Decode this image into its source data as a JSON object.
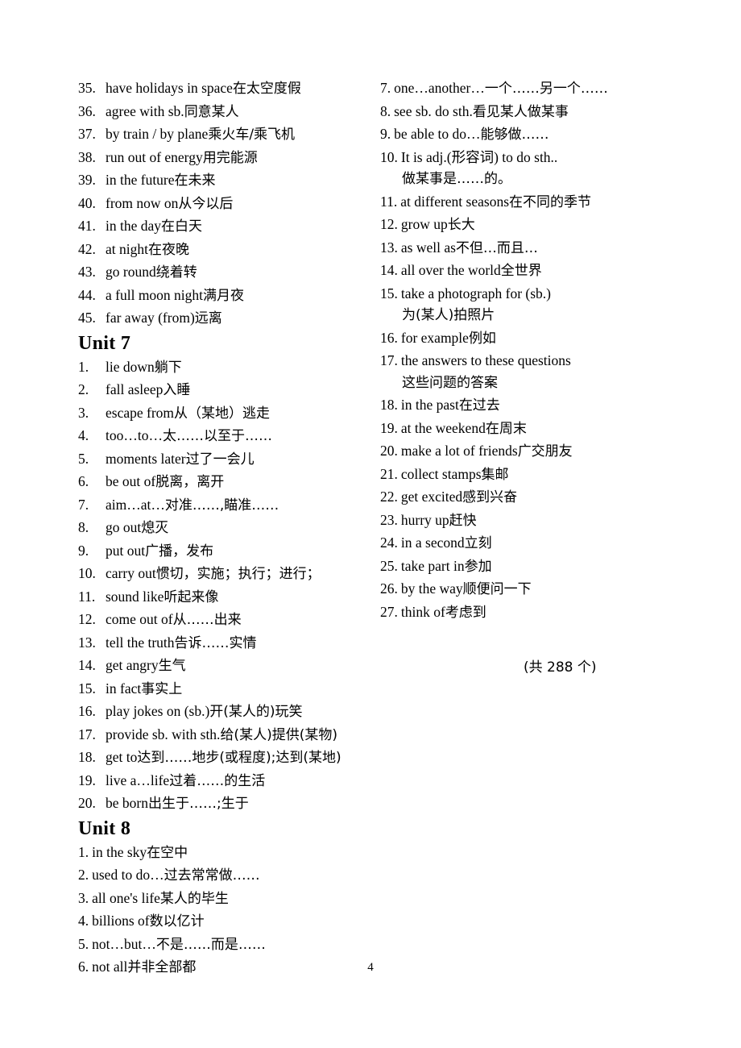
{
  "page": {
    "page_number": "4",
    "total_count_note": "(共 288 个)"
  },
  "left_column": {
    "continued_list": {
      "items": [
        {
          "num": "35.",
          "en": "have holidays in space",
          "gap": "     ",
          "zh": "在太空度假"
        },
        {
          "num": "36.",
          "en": "agree with sb.",
          "gap": "     ",
          "zh": "同意某人"
        },
        {
          "num": "37.",
          "en": "by train / by plane",
          "gap": " ",
          "zh": "乘火车/乘飞机"
        },
        {
          "num": "38.",
          "en": "run out of energy",
          "gap": "    ",
          "zh": "用完能源"
        },
        {
          "num": "39.",
          "en": "in the future",
          "gap": "    ",
          "zh": "在未来"
        },
        {
          "num": "40.",
          "en": "from now on",
          "gap": "     ",
          "zh": "从今以后"
        },
        {
          "num": "41.",
          "en": "in the day",
          "gap": "     ",
          "zh": "在白天"
        },
        {
          "num": "42.",
          "en": "at night",
          "gap": "     ",
          "zh": "在夜晚"
        },
        {
          "num": "43.",
          "en": "go round",
          "gap": "     ",
          "zh": "绕着转"
        },
        {
          "num": "44.",
          "en": "a full moon night",
          "gap": "     ",
          "zh": "满月夜"
        },
        {
          "num": "45.",
          "en": "far away (from)",
          "gap": "     ",
          "zh": "远离"
        }
      ]
    },
    "unit7": {
      "heading": "Unit 7",
      "items": [
        {
          "num": "1.",
          "en": "lie down",
          "gap": "     ",
          "zh": "躺下"
        },
        {
          "num": "2.",
          "en": "fall asleep",
          "gap": "     ",
          "zh": "入睡"
        },
        {
          "num": "3.",
          "en": "escape from",
          "gap": "     ",
          "zh": "从（某地）逃走"
        },
        {
          "num": "4.",
          "en": "too…to…",
          "gap": "     ",
          "zh": "太……以至于……"
        },
        {
          "num": "5.",
          "en": "moments later",
          "gap": "    ",
          "zh": "过了一会儿"
        },
        {
          "num": "6.",
          "en": "be out of",
          "gap": "     ",
          "zh": "脱离，离开"
        },
        {
          "num": "7.",
          "en": "aim…at…",
          "gap": "     ",
          "zh": "对准……,瞄准……"
        },
        {
          "num": "8.",
          "en": "go out",
          "gap": "     ",
          "zh": "熄灭"
        },
        {
          "num": "9.",
          "en": "put out",
          "gap": "     ",
          "zh": "广播，发布"
        },
        {
          "num": "10.",
          "en": "carry out",
          "gap": "     ",
          "zh": "惯切，实施；执行；进行；"
        },
        {
          "num": "11.",
          "en": "sound like",
          "gap": "     ",
          "zh": "听起来像"
        },
        {
          "num": "12.",
          "en": "come out of",
          "gap": "     ",
          "zh": "从……出来"
        },
        {
          "num": "13.",
          "en": "tell the truth",
          "gap": "     ",
          "zh": "告诉……实情"
        },
        {
          "num": "14.",
          "en": "get angry",
          "gap": "     ",
          "zh": "生气"
        },
        {
          "num": "15.",
          "en": "in fact",
          "gap": "     ",
          "zh": "事实上"
        },
        {
          "num": "16.",
          "en": "play jokes on (sb.)",
          "gap": "     ",
          "zh": "开(某人的)玩笑"
        },
        {
          "num": "17.",
          "en": "provide sb. with sth.",
          "gap": " ",
          "zh": "给(某人)提供(某物)"
        },
        {
          "num": "18.",
          "en": "get to",
          "gap": " ",
          "zh": "达到……地步(或程度);达到(某地)"
        },
        {
          "num": "19.",
          "en": "live a…life",
          "gap": "     ",
          "zh": "过着……的生活"
        },
        {
          "num": "20.",
          "en": "be born",
          "gap": "     ",
          "zh": "出生于……;生于"
        }
      ]
    },
    "unit8": {
      "heading": "Unit 8",
      "items": [
        {
          "num": "1.",
          "en": "in the sky",
          "gap": "     ",
          "zh": "在空中"
        },
        {
          "num": "2.",
          "en": "used to do…",
          "gap": "     ",
          "zh": "过去常常做……"
        },
        {
          "num": "3.",
          "en": "all one's life",
          "gap": "     ",
          "zh": "某人的毕生"
        },
        {
          "num": "4.",
          "en": "billions of",
          "gap": "     ",
          "zh": "数以亿计"
        },
        {
          "num": "5.",
          "en": "not…but…",
          "gap": "     ",
          "zh": "不是……而是……"
        },
        {
          "num": "6.",
          "en": "not all",
          "gap": "     ",
          "zh": "并非全部都"
        }
      ]
    }
  },
  "right_column": {
    "continued_list": {
      "items": [
        {
          "num": "7.",
          "en": "one…another…",
          "gap": "",
          "zh": "一个……另一个……",
          "cont": ""
        },
        {
          "num": "8.",
          "en": "see sb. do sth.",
          "gap": "     ",
          "zh": "看见某人做某事",
          "cont": ""
        },
        {
          "num": "9.",
          "en": "be able to do…",
          "gap": "     ",
          "zh": "能够做……",
          "cont": ""
        },
        {
          "num": "10.",
          "en": "It is adj.(形容词) to do sth..",
          "gap": "",
          "zh": "",
          "cont": "做某事是……的。"
        },
        {
          "num": "11.",
          "en": "at different seasons",
          "gap": "     ",
          "zh": "在不同的季节",
          "cont": ""
        },
        {
          "num": "12.",
          "en": "grow up",
          "gap": "     ",
          "zh": "长大",
          "cont": ""
        },
        {
          "num": "13.",
          "en": "as well as",
          "gap": "     ",
          "zh": "不但…而且…",
          "cont": ""
        },
        {
          "num": "14.",
          "en": "all over the world",
          "gap": "     ",
          "zh": "全世界",
          "cont": ""
        },
        {
          "num": "15.",
          "en": "take a photograph for (sb.)",
          "gap": "",
          "zh": "",
          "cont": "为(某人)拍照片"
        },
        {
          "num": "16.",
          "en": "for example",
          "gap": "     ",
          "zh": "例如",
          "cont": ""
        },
        {
          "num": "17.",
          "en": "the answers to these questions",
          "gap": "",
          "zh": "",
          "cont": "这些问题的答案"
        },
        {
          "num": "18.",
          "en": "in the past",
          "gap": "     ",
          "zh": "在过去",
          "cont": ""
        },
        {
          "num": "19.",
          "en": "at the weekend",
          "gap": "     ",
          "zh": "在周末",
          "cont": ""
        },
        {
          "num": "20.",
          "en": "make a lot of friends",
          "gap": "     ",
          "zh": "广交朋友",
          "cont": ""
        },
        {
          "num": "21.",
          "en": "collect stamps",
          "gap": "     ",
          "zh": "集邮",
          "cont": ""
        },
        {
          "num": "22.",
          "en": "get excited",
          "gap": "     ",
          "zh": "感到兴奋",
          "cont": ""
        },
        {
          "num": "23.",
          "en": "hurry up",
          "gap": "     ",
          "zh": "赶快",
          "cont": ""
        },
        {
          "num": "24.",
          "en": "in a second",
          "gap": "     ",
          "zh": "立刻",
          "cont": ""
        },
        {
          "num": "25.",
          "en": "take part in",
          "gap": "     ",
          "zh": "参加",
          "cont": ""
        },
        {
          "num": "26.",
          "en": "by the way",
          "gap": "     ",
          "zh": "顺便问一下",
          "cont": ""
        },
        {
          "num": "27.",
          "en": "think of",
          "gap": "     ",
          "zh": "考虑到",
          "cont": ""
        }
      ]
    }
  }
}
